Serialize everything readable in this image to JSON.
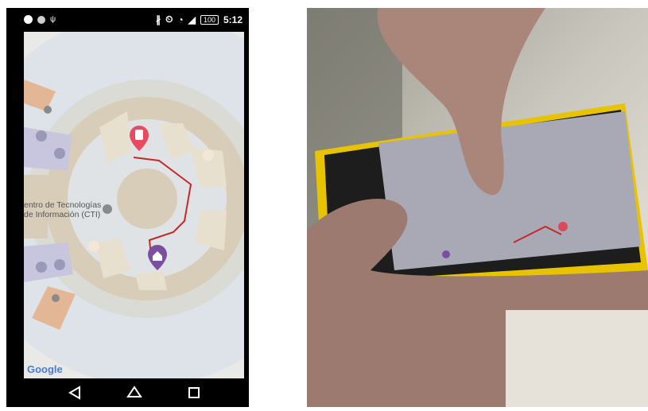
{
  "status_bar": {
    "battery": "100",
    "time": "5:12"
  },
  "map": {
    "building_label_line1": "entro de Tecnologías",
    "building_label_line2": "de Información (CTI)",
    "attribution": "Google",
    "route_color": "#c62828",
    "origin_marker_color": "#e84a5f",
    "destination_marker_color": "#7b4fa0",
    "icons": [
      "phone-marker-icon",
      "home-marker-icon",
      "restaurant-icon",
      "restroom-icon",
      "info-icon"
    ]
  },
  "nav_bar": {
    "icons": [
      "back-icon",
      "home-icon",
      "recents-icon"
    ]
  },
  "photo": {
    "subject": "hand-holding-phone",
    "phone_case_color": "#e8c400"
  }
}
